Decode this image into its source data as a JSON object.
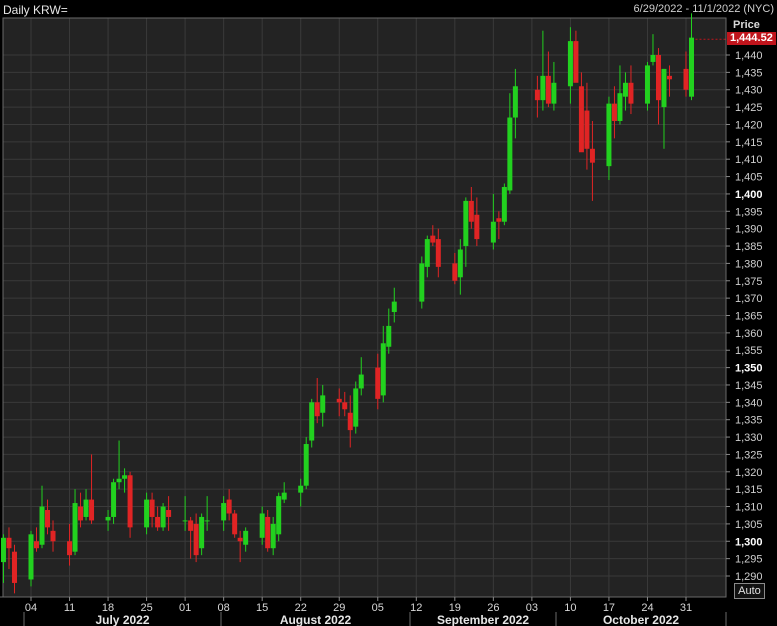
{
  "header": {
    "title": "Daily KRW=",
    "range": "6/29/2022 - 11/1/2022 (NYC)",
    "price_label": "Price"
  },
  "auto_label": "Auto",
  "last_price": "1,444.52",
  "colors": {
    "up": "#22d11f",
    "down": "#e02424",
    "grid": "#3a3a3a",
    "background": "#232323"
  },
  "chart_data": {
    "type": "candlestick",
    "ylim": [
      1285,
      1452
    ],
    "y_ticks": [
      1290,
      1295,
      1300,
      1305,
      1310,
      1315,
      1320,
      1325,
      1330,
      1335,
      1340,
      1345,
      1350,
      1355,
      1360,
      1365,
      1370,
      1375,
      1380,
      1385,
      1390,
      1395,
      1400,
      1405,
      1410,
      1415,
      1420,
      1425,
      1430,
      1435,
      1440
    ],
    "y_major_ticks": [
      1300,
      1350,
      1400
    ],
    "x_ticks": [
      "04",
      "11",
      "18",
      "25",
      "01",
      "08",
      "15",
      "22",
      "29",
      "05",
      "12",
      "19",
      "26",
      "03",
      "10",
      "17",
      "24",
      "31"
    ],
    "months": [
      "July 2022",
      "August 2022",
      "September 2022",
      "October 2022"
    ],
    "candles": [
      [
        "2022-06-29",
        1294,
        1302,
        1288,
        1301
      ],
      [
        "2022-06-30",
        1301,
        1304,
        1292,
        1298
      ],
      [
        "2022-07-01",
        1297,
        1299,
        1285,
        1288
      ],
      [
        "2022-07-04",
        1289,
        1303,
        1287,
        1302
      ],
      [
        "2022-07-05",
        1300,
        1304,
        1297,
        1298
      ],
      [
        "2022-07-06",
        1299,
        1316,
        1298,
        1310
      ],
      [
        "2022-07-07",
        1309,
        1312,
        1302,
        1304
      ],
      [
        "2022-07-08",
        1303,
        1306,
        1297,
        1300
      ],
      [
        "2022-07-11",
        1300,
        1305,
        1293,
        1296
      ],
      [
        "2022-07-12",
        1297,
        1315,
        1296,
        1311
      ],
      [
        "2022-07-13",
        1310,
        1314,
        1304,
        1306
      ],
      [
        "2022-07-14",
        1307,
        1315,
        1306,
        1312
      ],
      [
        "2022-07-15",
        1312,
        1325,
        1305,
        1306
      ],
      [
        "2022-07-18",
        1306,
        1309,
        1303,
        1307
      ],
      [
        "2022-07-19",
        1307,
        1318,
        1305,
        1317
      ],
      [
        "2022-07-20",
        1317,
        1329,
        1315,
        1318
      ],
      [
        "2022-07-21",
        1318,
        1321,
        1314,
        1319
      ],
      [
        "2022-07-22",
        1319,
        1320,
        1301,
        1304
      ],
      [
        "2022-07-25",
        1304,
        1314,
        1302,
        1312
      ],
      [
        "2022-07-26",
        1312,
        1314,
        1304,
        1307
      ],
      [
        "2022-07-27",
        1307,
        1310,
        1303,
        1304
      ],
      [
        "2022-07-28",
        1304,
        1311,
        1303,
        1310
      ],
      [
        "2022-07-29",
        1309,
        1313,
        1303,
        1307
      ],
      [
        "2022-08-01",
        1306,
        1313,
        1303,
        1306
      ],
      [
        "2022-08-02",
        1306,
        1307,
        1295,
        1303
      ],
      [
        "2022-08-03",
        1305,
        1308,
        1294,
        1296
      ],
      [
        "2022-08-04",
        1298,
        1308,
        1296,
        1307
      ],
      [
        "2022-08-05",
        1306,
        1313,
        1303,
        1306
      ],
      [
        "2022-08-08",
        1306,
        1313,
        1303,
        1311
      ],
      [
        "2022-08-09",
        1312,
        1315,
        1306,
        1308
      ],
      [
        "2022-08-10",
        1308,
        1309,
        1301,
        1302
      ],
      [
        "2022-08-11",
        1301,
        1303,
        1294,
        1300
      ],
      [
        "2022-08-12",
        1299,
        1304,
        1297,
        1303
      ],
      [
        "2022-08-15",
        1301,
        1310,
        1299,
        1308
      ],
      [
        "2022-08-16",
        1307,
        1309,
        1297,
        1298
      ],
      [
        "2022-08-17",
        1298,
        1307,
        1296,
        1305
      ],
      [
        "2022-08-18",
        1302,
        1314,
        1300,
        1313
      ],
      [
        "2022-08-19",
        1312,
        1317,
        1311,
        1314
      ],
      [
        "2022-08-22",
        1314,
        1318,
        1310,
        1316
      ],
      [
        "2022-08-23",
        1316,
        1330,
        1315,
        1328
      ],
      [
        "2022-08-24",
        1329,
        1341,
        1327,
        1340
      ],
      [
        "2022-08-25",
        1340,
        1347,
        1334,
        1336
      ],
      [
        "2022-08-26",
        1337,
        1345,
        1333,
        1342
      ],
      [
        "2022-08-29",
        1341,
        1344,
        1336,
        1340
      ],
      [
        "2022-08-30",
        1340,
        1343,
        1336,
        1338
      ],
      [
        "2022-08-31",
        1337,
        1342,
        1327,
        1332
      ],
      [
        "2022-09-01",
        1333,
        1346,
        1331,
        1344
      ],
      [
        "2022-09-02",
        1344,
        1353,
        1342,
        1348
      ],
      [
        "2022-09-05",
        1350,
        1354,
        1338,
        1341
      ],
      [
        "2022-09-06",
        1342,
        1362,
        1340,
        1357
      ],
      [
        "2022-09-07",
        1356,
        1367,
        1354,
        1362
      ],
      [
        "2022-09-08",
        1366,
        1373,
        1363,
        1369
      ],
      [
        "2022-09-13",
        1369,
        1382,
        1367,
        1380
      ],
      [
        "2022-09-14",
        1379,
        1388,
        1376,
        1387
      ],
      [
        "2022-09-15",
        1388,
        1391,
        1385,
        1386
      ],
      [
        "2022-09-16",
        1387,
        1390,
        1376,
        1379
      ],
      [
        "2022-09-19",
        1380,
        1383,
        1374,
        1375
      ],
      [
        "2022-09-20",
        1376,
        1387,
        1371,
        1384
      ],
      [
        "2022-09-21",
        1385,
        1399,
        1379,
        1398
      ],
      [
        "2022-09-22",
        1398,
        1402,
        1390,
        1392
      ],
      [
        "2022-09-23",
        1394,
        1399,
        1385,
        1387
      ],
      [
        "2022-09-26",
        1386,
        1400,
        1384,
        1392
      ],
      [
        "2022-09-27",
        1393,
        1395,
        1387,
        1392
      ],
      [
        "2022-09-28",
        1392,
        1403,
        1391,
        1402
      ],
      [
        "2022-09-29",
        1401,
        1429,
        1400,
        1422
      ],
      [
        "2022-09-30",
        1422,
        1436,
        1416,
        1431
      ],
      [
        "2022-10-04",
        1430,
        1434,
        1422,
        1427
      ],
      [
        "2022-10-05",
        1427,
        1447,
        1424,
        1434
      ],
      [
        "2022-10-06",
        1434,
        1441,
        1425,
        1426
      ],
      [
        "2022-10-07",
        1426,
        1438,
        1424,
        1432
      ],
      [
        "2022-10-10",
        1431,
        1448,
        1426,
        1444
      ],
      [
        "2022-10-11",
        1444,
        1447,
        1433,
        1432
      ],
      [
        "2022-10-12",
        1431,
        1435,
        1413,
        1412
      ],
      [
        "2022-10-13",
        1424,
        1432,
        1407,
        1413
      ],
      [
        "2022-10-14",
        1413,
        1421,
        1398,
        1409
      ],
      [
        "2022-10-17",
        1408,
        1428,
        1404,
        1426
      ],
      [
        "2022-10-18",
        1426,
        1431,
        1416,
        1421
      ],
      [
        "2022-10-19",
        1421,
        1437,
        1420,
        1429
      ],
      [
        "2022-10-20",
        1428,
        1435,
        1424,
        1432
      ],
      [
        "2022-10-21",
        1432,
        1437,
        1423,
        1426
      ],
      [
        "2022-10-24",
        1426,
        1438,
        1424,
        1437
      ],
      [
        "2022-10-25",
        1438,
        1446,
        1437,
        1440
      ],
      [
        "2022-10-26",
        1440,
        1442,
        1420,
        1427
      ],
      [
        "2022-10-27",
        1425,
        1436,
        1413,
        1436
      ],
      [
        "2022-10-28",
        1434,
        1437,
        1428,
        1433
      ],
      [
        "2022-10-31",
        1436,
        1441,
        1428,
        1430
      ],
      [
        "2022-11-01",
        1428,
        1452,
        1427,
        1445
      ]
    ]
  }
}
